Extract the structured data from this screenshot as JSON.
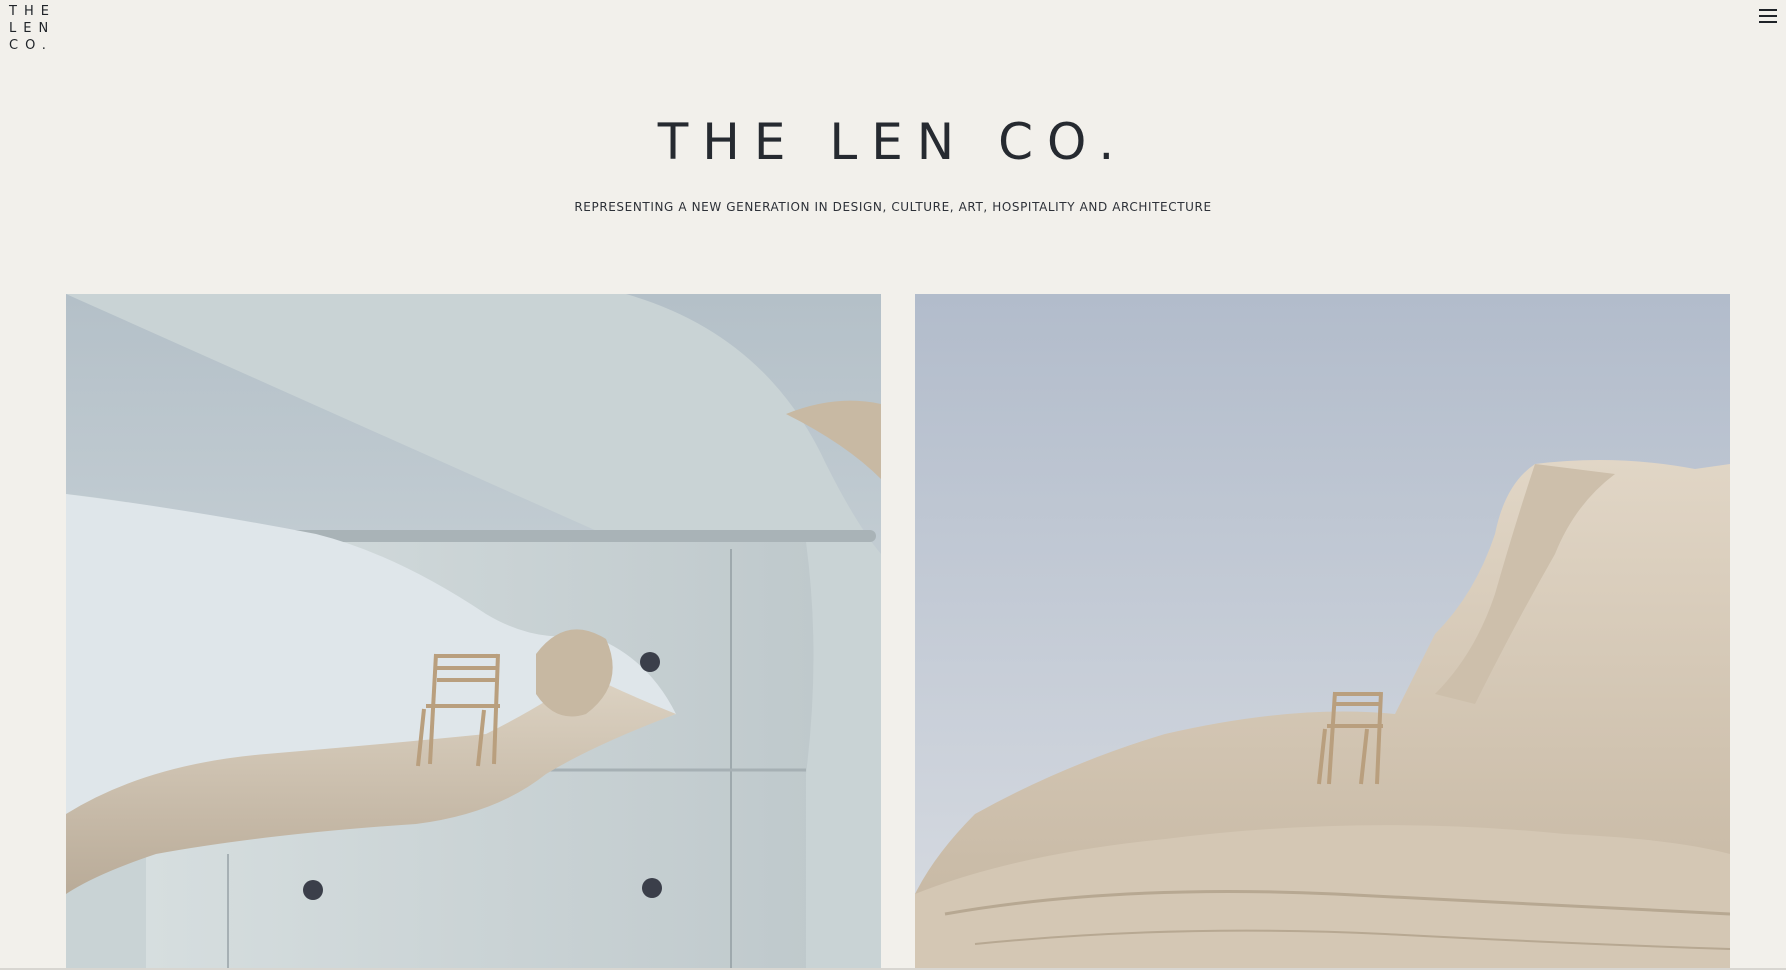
{
  "logo": {
    "line1": "THE",
    "line2": "LEN",
    "line3": "CO."
  },
  "menu": {
    "icon": "hamburger-menu-icon"
  },
  "hero": {
    "title": "THE LEN CO.",
    "subtitle": "REPRESENTING A NEW GENERATION IN DESIGN, CULTURE, ART, HOSPITALITY AND ARCHITECTURE"
  },
  "gallery": {
    "images": [
      {
        "subject": "white-cabinet-chair-on-rock-image"
      },
      {
        "subject": "chair-on-rock-cliff-image"
      }
    ]
  },
  "colors": {
    "background": "#f2f0eb",
    "text": "#23262b",
    "sky": "#b7c0cc",
    "rock": "#d9cdbb"
  }
}
